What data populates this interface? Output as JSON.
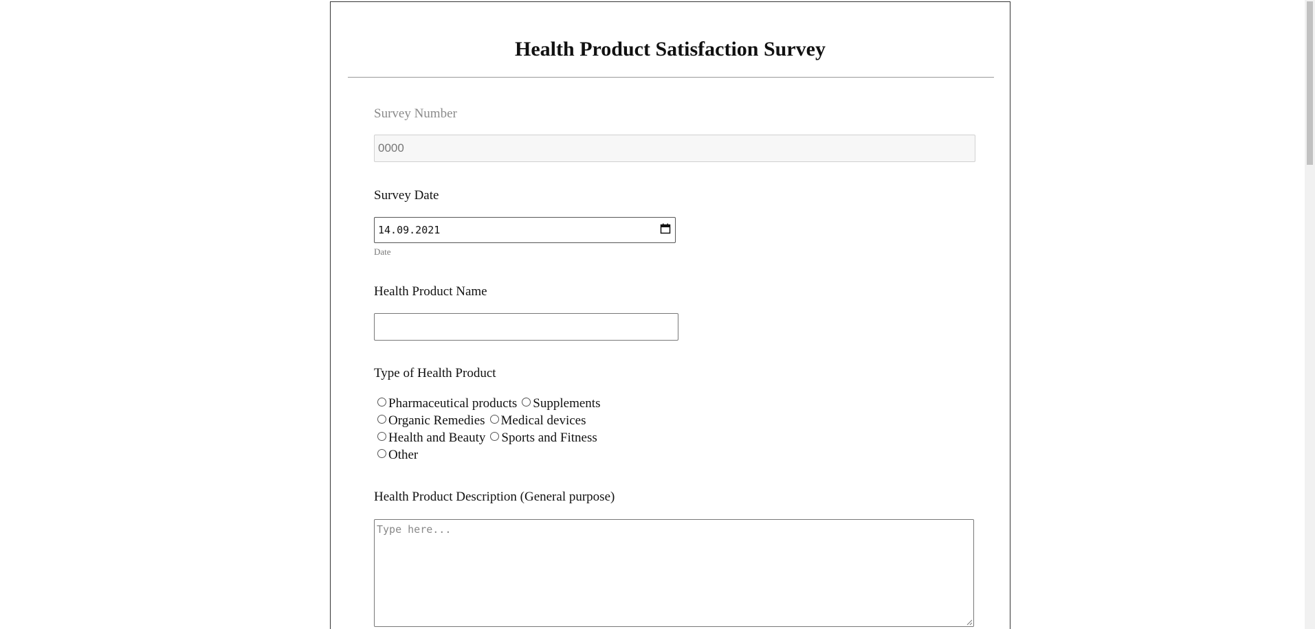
{
  "form": {
    "title": "Health Product Satisfaction Survey",
    "survey_number": {
      "label": "Survey Number",
      "placeholder": "0000"
    },
    "survey_date": {
      "label": "Survey Date",
      "value": "14.09.2021",
      "hint": "Date",
      "icon": "calendar-icon"
    },
    "product_name": {
      "label": "Health Product Name",
      "value": ""
    },
    "product_type": {
      "label": "Type of Health Product",
      "options": [
        "Pharmaceutical products",
        "Supplements",
        "Organic Remedies",
        "Medical devices",
        "Health and Beauty",
        "Sports and Fitness",
        "Other"
      ]
    },
    "description": {
      "label": "Health Product Description (General purpose)",
      "placeholder": "Type here..."
    }
  },
  "colors": {
    "border": "#333333",
    "muted_text": "#8a8a8a",
    "disabled_bg": "#f7f7f7"
  }
}
